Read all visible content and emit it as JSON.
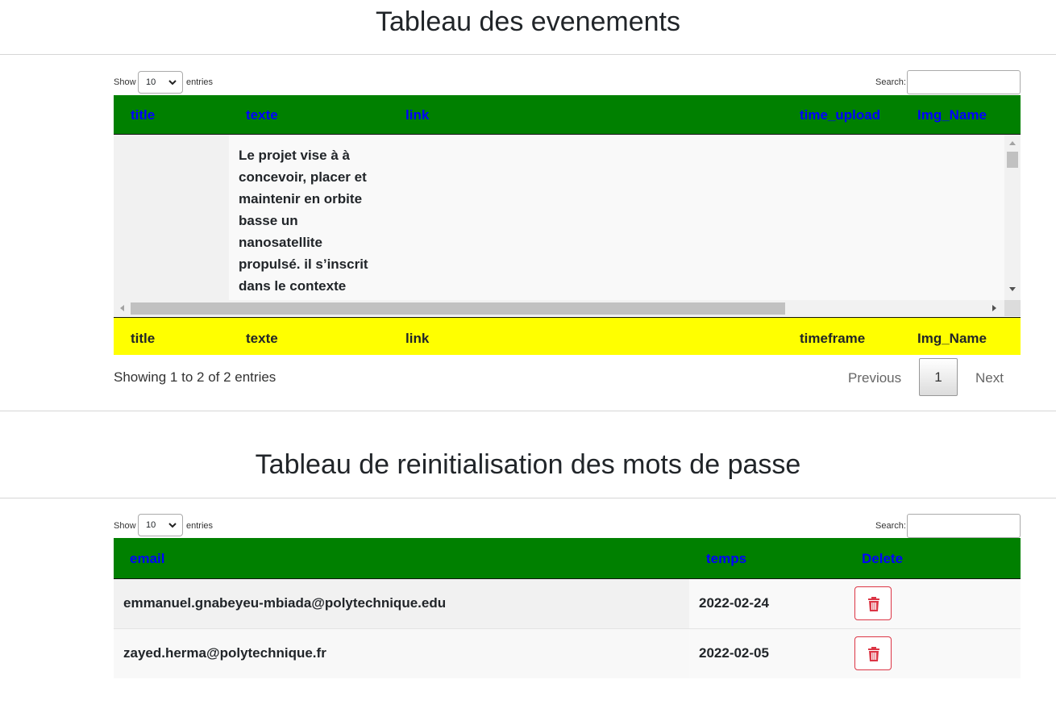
{
  "events": {
    "title": "Tableau des evenements",
    "show_label": "Show",
    "entries_label": "entries",
    "length_value": "10",
    "search_label": "Search:",
    "search_value": "",
    "columns": [
      "title",
      "texte",
      "link",
      "time_upload",
      "Img_Name"
    ],
    "footer_columns": [
      "title",
      "texte",
      "link",
      "timeframe",
      "Img_Name"
    ],
    "rows": [
      {
        "title": "",
        "texte_lines": [
          "Le projet vise à à",
          "concevoir, placer et",
          "maintenir en orbite",
          "basse un",
          "nanosatellite",
          "propulsé. il s’inscrit",
          "dans le contexte"
        ],
        "link": "",
        "time_upload": "",
        "img_name": ""
      }
    ],
    "info": "Showing 1 to 2 of 2 entries",
    "pagination": {
      "previous": "Previous",
      "page": "1",
      "next": "Next"
    }
  },
  "reset": {
    "title": "Tableau de reinitialisation des mots de passe",
    "show_label": "Show",
    "entries_label": "entries",
    "length_value": "10",
    "search_label": "Search:",
    "search_value": "",
    "columns": [
      "email",
      "temps",
      "Delete"
    ],
    "rows": [
      {
        "email": "emmanuel.gnabeyeu-mbiada@polytechnique.edu",
        "temps": "2022-02-24",
        "delete_icon": "trash-icon"
      },
      {
        "email": "zayed.herma@polytechnique.fr",
        "temps": "2022-02-05",
        "delete_icon": "trash-icon"
      }
    ]
  },
  "colors": {
    "header_green": "#008000",
    "header_text_blue": "#0000ff",
    "footer_yellow": "#ffff00",
    "danger_red": "#dc3545"
  }
}
